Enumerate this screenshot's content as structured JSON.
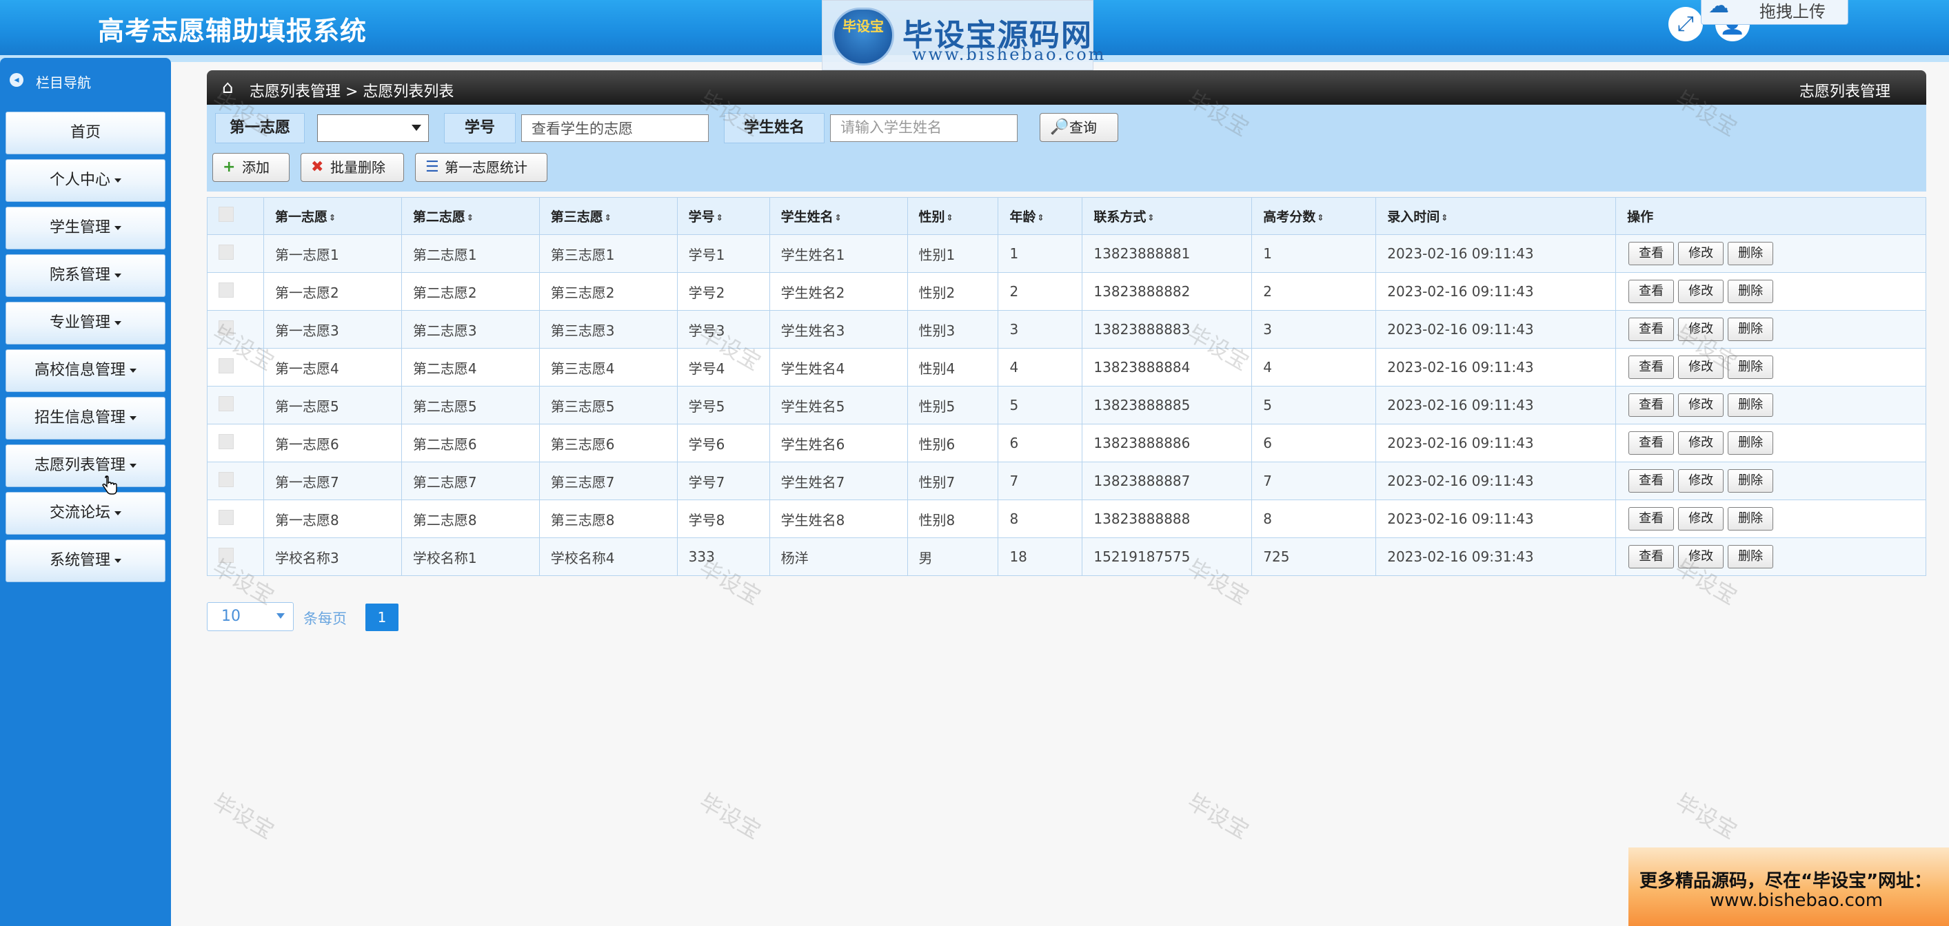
{
  "app": {
    "title": "高考志愿辅助填报系统",
    "logo_name": "毕设宝源码网",
    "logo_url": "www.bishebao.com",
    "logo_badge": "毕设宝",
    "upload_tip": "拖拽上传"
  },
  "sidebar": {
    "header": "栏目导航",
    "items": [
      {
        "label": "首页",
        "has_caret": false
      },
      {
        "label": "个人中心",
        "has_caret": true
      },
      {
        "label": "学生管理",
        "has_caret": true
      },
      {
        "label": "院系管理",
        "has_caret": true
      },
      {
        "label": "专业管理",
        "has_caret": true
      },
      {
        "label": "高校信息管理",
        "has_caret": true
      },
      {
        "label": "招生信息管理",
        "has_caret": true
      },
      {
        "label": "志愿列表管理",
        "has_caret": true
      },
      {
        "label": "交流论坛",
        "has_caret": true
      },
      {
        "label": "系统管理",
        "has_caret": true
      }
    ]
  },
  "breadcrumb": {
    "path": "志愿列表管理 > 志愿列表列表",
    "right": "志愿列表管理"
  },
  "filters": {
    "first_choice_label": "第一志愿",
    "first_choice_value": "",
    "student_id_label": "学号",
    "student_id_value": "查看学生的志愿",
    "student_name_label": "学生姓名",
    "student_name_placeholder": "请输入学生姓名",
    "search_button": "查询"
  },
  "toolbar": {
    "add": "添加",
    "batch_delete": "批量删除",
    "stats": "第一志愿统计"
  },
  "table": {
    "headers": [
      "第一志愿",
      "第二志愿",
      "第三志愿",
      "学号",
      "学生姓名",
      "性别",
      "年龄",
      "联系方式",
      "高考分数",
      "录入时间",
      "操作"
    ],
    "actions": {
      "view": "查看",
      "edit": "修改",
      "delete": "删除"
    },
    "rows": [
      [
        "第一志愿1",
        "第二志愿1",
        "第三志愿1",
        "学号1",
        "学生姓名1",
        "性别1",
        "1",
        "13823888881",
        "1",
        "2023-02-16 09:11:43"
      ],
      [
        "第一志愿2",
        "第二志愿2",
        "第三志愿2",
        "学号2",
        "学生姓名2",
        "性别2",
        "2",
        "13823888882",
        "2",
        "2023-02-16 09:11:43"
      ],
      [
        "第一志愿3",
        "第二志愿3",
        "第三志愿3",
        "学号3",
        "学生姓名3",
        "性别3",
        "3",
        "13823888883",
        "3",
        "2023-02-16 09:11:43"
      ],
      [
        "第一志愿4",
        "第二志愿4",
        "第三志愿4",
        "学号4",
        "学生姓名4",
        "性别4",
        "4",
        "13823888884",
        "4",
        "2023-02-16 09:11:43"
      ],
      [
        "第一志愿5",
        "第二志愿5",
        "第三志愿5",
        "学号5",
        "学生姓名5",
        "性别5",
        "5",
        "13823888885",
        "5",
        "2023-02-16 09:11:43"
      ],
      [
        "第一志愿6",
        "第二志愿6",
        "第三志愿6",
        "学号6",
        "学生姓名6",
        "性别6",
        "6",
        "13823888886",
        "6",
        "2023-02-16 09:11:43"
      ],
      [
        "第一志愿7",
        "第二志愿7",
        "第三志愿7",
        "学号7",
        "学生姓名7",
        "性别7",
        "7",
        "13823888887",
        "7",
        "2023-02-16 09:11:43"
      ],
      [
        "第一志愿8",
        "第二志愿8",
        "第三志愿8",
        "学号8",
        "学生姓名8",
        "性别8",
        "8",
        "13823888888",
        "8",
        "2023-02-16 09:11:43"
      ],
      [
        "学校名称3",
        "学校名称1",
        "学校名称4",
        "333",
        "杨洋",
        "男",
        "18",
        "15219187575",
        "725",
        "2023-02-16 09:31:43"
      ]
    ]
  },
  "pagination": {
    "page_size": "10",
    "page_size_label": "条每页",
    "current_page": "1"
  },
  "watermark": "毕设宝",
  "ad": {
    "line1": "更多精品源码，尽在“毕设宝”网址：",
    "line2": "www.bishebao.com"
  },
  "colors": {
    "header_blue": "#1b8ce0",
    "sidebar_blue": "#1b7fd8",
    "crumb_dark": "#1a1a1a",
    "filter_bg": "#b9dcf8",
    "page_active": "#1b86e0"
  }
}
